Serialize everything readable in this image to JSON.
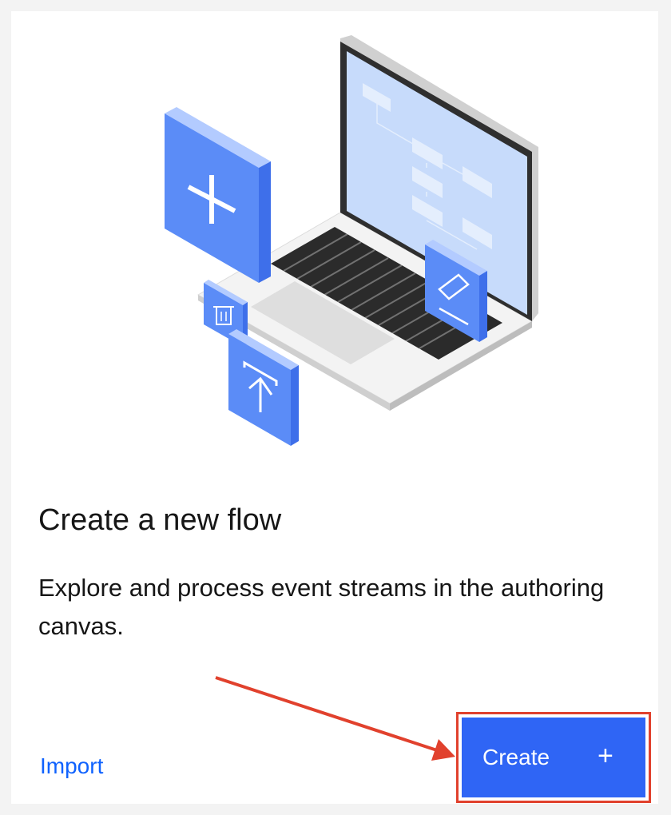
{
  "card": {
    "title": "Create a new flow",
    "description": "Explore and process event streams in the authoring canvas."
  },
  "actions": {
    "import_label": "Import",
    "create_label": "Create",
    "create_icon": "+"
  },
  "illustration": {
    "description_icons": [
      "laptop-icon",
      "plus-icon",
      "trash-icon",
      "upload-icon",
      "edit-icon"
    ]
  },
  "annotation": {
    "highlight_color": "#e1412d",
    "arrow_color": "#e1412d"
  },
  "colors": {
    "accent": "#0f62fe",
    "button_bg": "#2f65f5",
    "tile_blue": "#5b8cf7",
    "screen_blue": "#c9dcfb"
  }
}
